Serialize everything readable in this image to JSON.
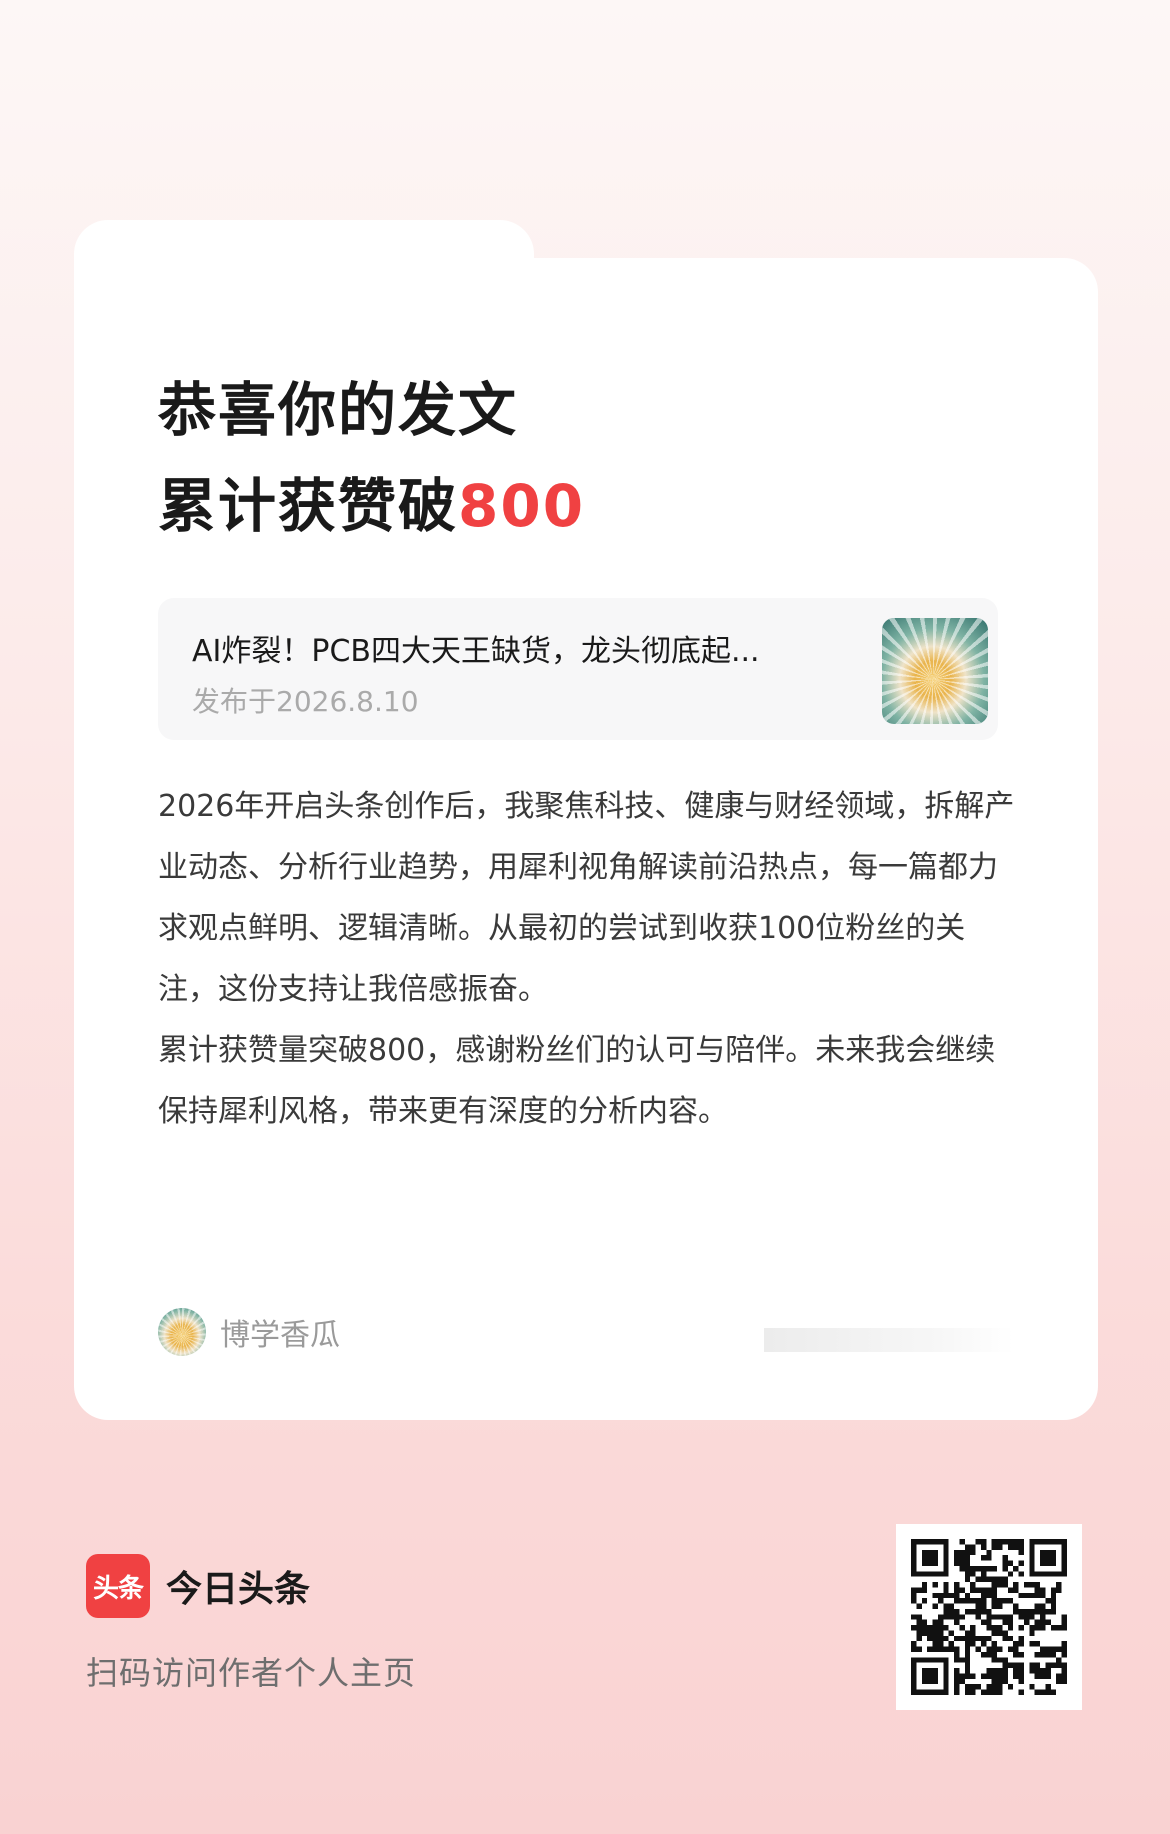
{
  "card": {
    "title_line1": "恭喜你的发文",
    "title_line2_prefix": "累计获赞破",
    "title_number": "800",
    "accent_color": "#f04142"
  },
  "article": {
    "title": "AI炸裂！PCB四大天王缺货，龙头彻底起...",
    "date": "发布于2026.8.10",
    "thumb_icon": "sea-urchin-thumbnail"
  },
  "body": {
    "paragraph1": "2026年开启头条创作后，我聚焦科技、健康与财经领域，拆解产业动态、分析行业趋势，用犀利视角解读前沿热点，每一篇都力求观点鲜明、逻辑清晰。从最初的尝试到收获100位粉丝的关注，这份支持让我倍感振奋。",
    "paragraph2": "累计获赞量突破800，感谢粉丝们的认可与陪伴。未来我会继续保持犀利风格，带来更有深度的分析内容。"
  },
  "author": {
    "name": "博学香瓜"
  },
  "footer": {
    "logo_text": "头条",
    "brand_name": "今日头条",
    "scan_text": "扫码访问作者个人主页",
    "qr_icon": "qr-code"
  }
}
